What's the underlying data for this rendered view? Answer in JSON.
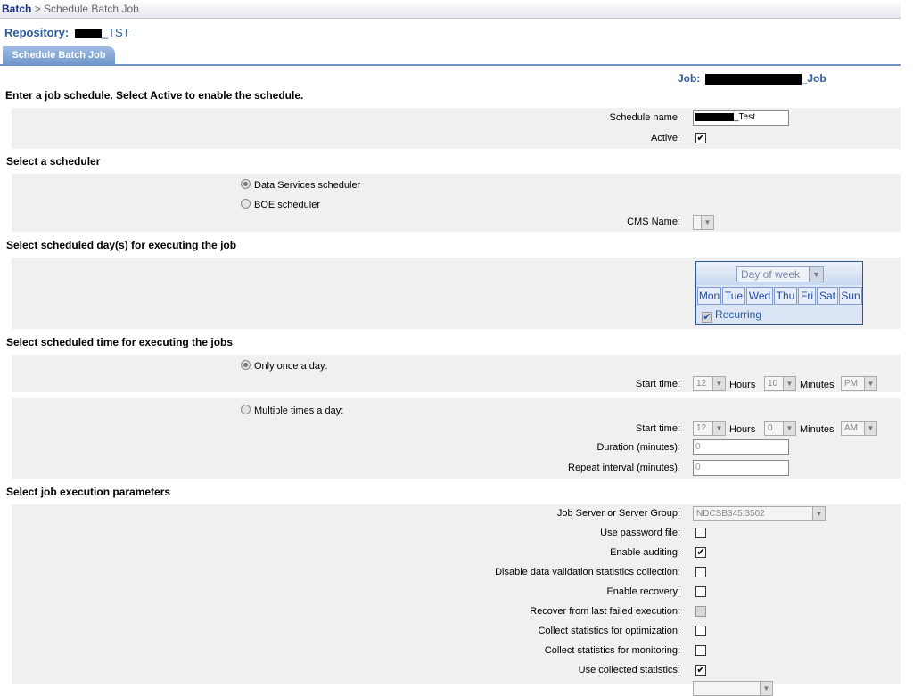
{
  "breadcrumb": {
    "link": "Batch",
    "separator": ">",
    "current": "Schedule Batch Job"
  },
  "repository": {
    "label": "Repository:",
    "suffix": "_TST"
  },
  "tab": {
    "label": "Schedule Batch Job"
  },
  "job": {
    "label": "Job:",
    "suffix": "_Job"
  },
  "intro": "Enter a job schedule. Select Active to enable the schedule.",
  "schedule": {
    "name_label": "Schedule name:",
    "name_suffix": "_Test",
    "active_label": "Active:",
    "active_checked": true
  },
  "scheduler": {
    "heading": "Select a scheduler",
    "options": [
      "Data Services scheduler",
      "BOE scheduler"
    ],
    "selected": "Data Services scheduler",
    "cms_label": "CMS Name:"
  },
  "days": {
    "heading": "Select scheduled day(s) for executing the job",
    "mode": "Day of week",
    "weekdays": [
      "Mon",
      "Tue",
      "Wed",
      "Thu",
      "Fri",
      "Sat",
      "Sun"
    ],
    "recurring_label": "Recurring",
    "recurring_checked": true
  },
  "time": {
    "heading": "Select scheduled time for executing the jobs",
    "once": {
      "label": "Only once a day:",
      "selected": true,
      "start_label": "Start time:",
      "hours": "12",
      "hours_unit": "Hours",
      "minutes": "10",
      "minutes_unit": "Minutes",
      "ampm": "PM"
    },
    "multiple": {
      "label": "Multiple times a day:",
      "selected": false,
      "start_label": "Start time:",
      "hours": "12",
      "hours_unit": "Hours",
      "minutes": "0",
      "minutes_unit": "Minutes",
      "ampm": "AM",
      "duration_label": "Duration (minutes):",
      "duration_value": "0",
      "repeat_label": "Repeat interval (minutes):",
      "repeat_value": "0"
    }
  },
  "params": {
    "heading": "Select job execution parameters",
    "server_label": "Job Server or Server Group:",
    "server_value": "NDCSB345:3502",
    "options": [
      {
        "label": "Use password file:",
        "checked": false,
        "disabled": false
      },
      {
        "label": "Enable auditing:",
        "checked": true,
        "disabled": false
      },
      {
        "label": "Disable data validation statistics collection:",
        "checked": false,
        "disabled": false
      },
      {
        "label": "Enable recovery:",
        "checked": false,
        "disabled": false
      },
      {
        "label": "Recover from last failed execution:",
        "checked": false,
        "disabled": true
      },
      {
        "label": "Collect statistics for optimization:",
        "checked": false,
        "disabled": false
      },
      {
        "label": "Collect statistics for monitoring:",
        "checked": false,
        "disabled": false
      },
      {
        "label": "Use collected statistics:",
        "checked": true,
        "disabled": false
      }
    ]
  },
  "colors": {
    "accent": "#2b5b9a",
    "link": "#1a2f8a",
    "panel": "#f0f0f0",
    "tab": "#6f96cb"
  }
}
